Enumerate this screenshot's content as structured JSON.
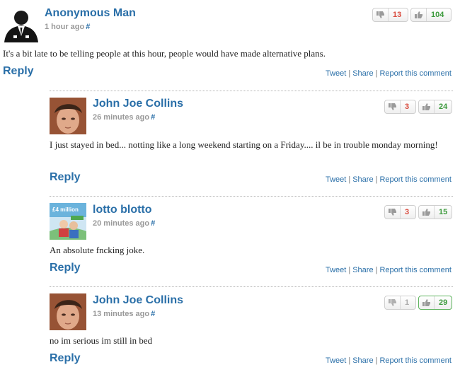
{
  "comments": [
    {
      "author": "Anonymous Man",
      "time": "1 hour ago",
      "hash": "#",
      "body": "It's a bit late to be telling people at this hour, people would have made alternative plans.",
      "dislikes": "13",
      "likes": "104",
      "reply": "Reply",
      "avatar_icon": "anonymous-suit-icon"
    },
    {
      "author": "John Joe Collins",
      "time": "26 minutes ago",
      "hash": "#",
      "body": "I just stayed in bed... notting like a long weekend starting on a Friday.... il be in trouble monday morning!",
      "dislikes": "3",
      "likes": "24",
      "reply": "Reply",
      "avatar_icon": "face-photo"
    },
    {
      "author": "lotto blotto",
      "time": "20 minutes ago",
      "hash": "#",
      "body": "An absolute fncking joke.",
      "dislikes": "3",
      "likes": "15",
      "reply": "Reply",
      "avatar_icon": "lotto-photo",
      "avatar_text": "£4 million"
    },
    {
      "author": "John Joe Collins",
      "time": "13 minutes ago",
      "hash": "#",
      "body": "no im serious im still in bed",
      "dislikes": "1",
      "likes": "29",
      "reply": "Reply",
      "avatar_icon": "face-photo"
    }
  ],
  "actions": {
    "tweet": "Tweet",
    "share": "Share",
    "report": "Report this comment",
    "sep": "|"
  },
  "colors": {
    "link": "#2a6fa8",
    "dislike": "#d94a3d",
    "like": "#3c9a3c"
  }
}
